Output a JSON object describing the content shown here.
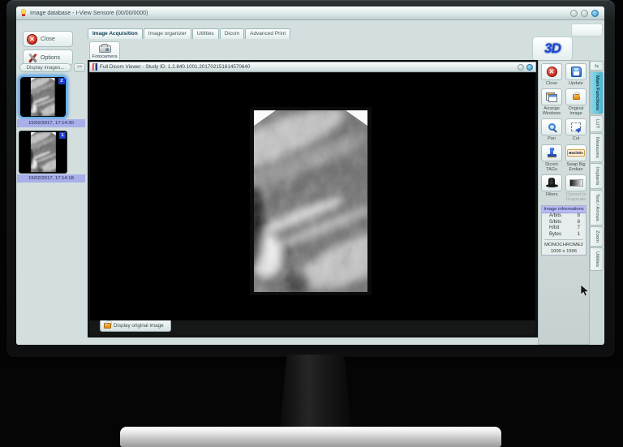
{
  "window": {
    "title": "Image database - I-View Sensore (00/00/0000)"
  },
  "tabs": [
    {
      "label": "Image Acquisition",
      "selected": true
    },
    {
      "label": "Image organizer",
      "selected": false
    },
    {
      "label": "Utilities",
      "selected": false
    },
    {
      "label": "Dicom",
      "selected": false
    },
    {
      "label": "Advanced Print",
      "selected": false
    }
  ],
  "left_toolbar": {
    "close_label": "Close",
    "options_label": "Options"
  },
  "acquisition_toolbar": {
    "fotocamera_label": "Fotocamera"
  },
  "thumbnail_panel": {
    "header": "Display images...",
    "collapse_label": ">>",
    "items": [
      {
        "badge": "2",
        "date": "15/02/2017, 17:14:30",
        "selected": true
      },
      {
        "badge": "1",
        "date": "15/02/2017, 17:14:18",
        "selected": false
      }
    ]
  },
  "viewer": {
    "title": "Full Dicom Viewer - Study ID: 1.2.840.1001.201702151614570640",
    "bottom_tab": "Display original image"
  },
  "logo": {
    "text": "3D"
  },
  "right_panel": {
    "buttons": [
      {
        "label": "Close"
      },
      {
        "label": "Update"
      },
      {
        "label": "Arrange Windows"
      },
      {
        "label": "Original Image"
      },
      {
        "label": "Pan"
      },
      {
        "label": "Cut"
      },
      {
        "label": "Dicom TAGs"
      },
      {
        "label": "Swap Big Endian"
      },
      {
        "label": "Filters"
      },
      {
        "label": "Convert to Grayscale",
        "disabled": true
      }
    ],
    "swap_icon_text": "BIGlittle",
    "image_info": {
      "header": "Image informations",
      "rows": [
        {
          "key": "A/bits",
          "value": "8"
        },
        {
          "key": "S/bits",
          "value": "8"
        },
        {
          "key": "H/bit",
          "value": "7"
        },
        {
          "key": "Bytes",
          "value": "1"
        }
      ],
      "photometric": "MONOCHROME2",
      "dimensions": "1000 x 1506"
    },
    "side_tabs": [
      {
        "label": "Main Functions",
        "selected": true
      },
      {
        "label": "LUT",
        "selected": false
      },
      {
        "label": "Measures",
        "selected": false
      },
      {
        "label": "Implants",
        "selected": false
      },
      {
        "label": "Text / Arrows",
        "selected": false
      },
      {
        "label": "Zoom",
        "selected": false
      },
      {
        "label": "Utilities",
        "selected": false
      }
    ]
  },
  "colors": {
    "selected_tab": "#5bc4de",
    "badge_blue": "#1c3fd2",
    "date_bar": "#a8afe9",
    "info_header": "#b8bbf2",
    "close_red": "#cc2b1c",
    "update_blue": "#2b66c8",
    "lock_orange": "#e8941f",
    "logo_blue": "#1d44cf"
  }
}
